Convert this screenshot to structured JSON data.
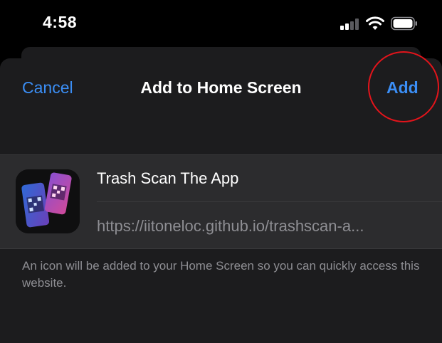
{
  "status_bar": {
    "time": "4:58",
    "signal_icon": "cellular-signal-icon",
    "wifi_icon": "wifi-icon",
    "battery_icon": "battery-icon"
  },
  "nav": {
    "cancel_label": "Cancel",
    "title": "Add to Home Screen",
    "add_label": "Add"
  },
  "bookmark": {
    "name": "Trash Scan The App",
    "url": "https://iitoneloc.github.io/trashscan-a..."
  },
  "footer": {
    "note": "An icon will be added to your Home Screen so you can quickly access this website."
  },
  "colors": {
    "accent": "#3b8ef5",
    "sheet_bg": "#1c1c1e",
    "group_bg": "#2c2c2e",
    "secondary_text": "#8e8e93",
    "highlight": "#e3141b"
  }
}
